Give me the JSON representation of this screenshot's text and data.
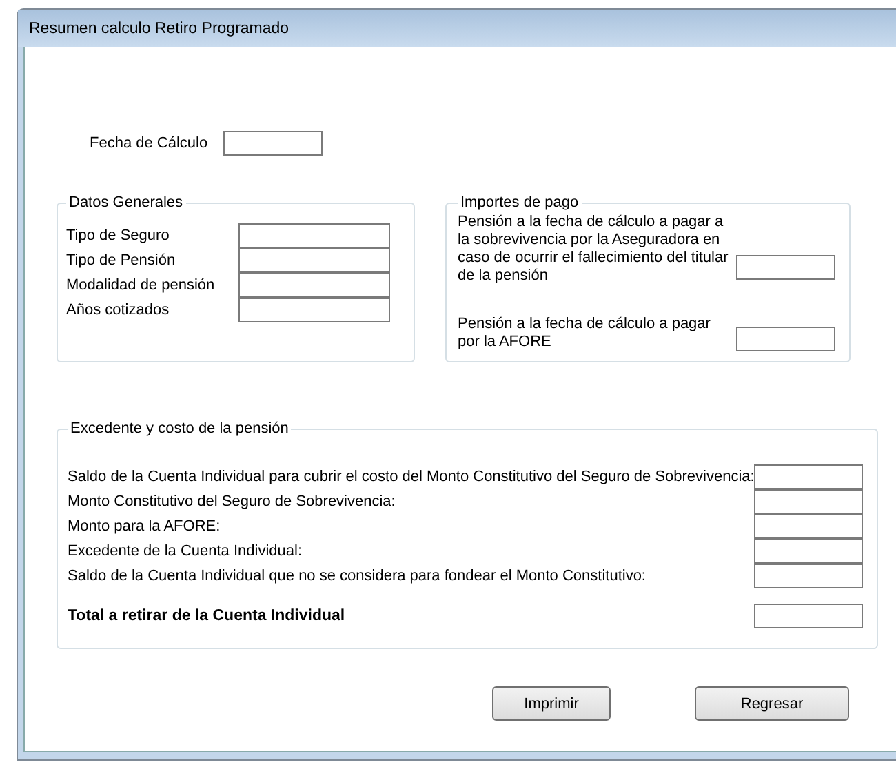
{
  "window": {
    "title": "Resumen calculo Retiro Programado"
  },
  "fecha_calculo": {
    "label": "Fecha de Cálculo"
  },
  "datos_generales": {
    "title": "Datos Generales",
    "rows": [
      {
        "label": "Tipo de Seguro"
      },
      {
        "label": "Tipo de Pensión"
      },
      {
        "label": "Modalidad de pensión"
      },
      {
        "label": "Años cotizados"
      }
    ]
  },
  "importes_de_pago": {
    "title": "Importes de pago",
    "rows": [
      {
        "label": "Pensión a la fecha de cálculo a pagar a la sobrevivencia por la Aseguradora en caso de ocurrir el fallecimiento del titular de la pensión"
      },
      {
        "label": "Pensión a la fecha de cálculo a pagar por la AFORE"
      }
    ]
  },
  "excedente": {
    "title": "Excedente y costo de la pensión",
    "rows": [
      {
        "kind": "line",
        "label": "Saldo de la Cuenta Individual para cubrir el costo del Monto Constitutivo del Seguro de Sobrevivencia:"
      },
      {
        "kind": "line",
        "label": "Monto Constitutivo del Seguro de Sobrevivencia:"
      },
      {
        "kind": "line",
        "label": "Monto para la AFORE:"
      },
      {
        "kind": "line",
        "label": "Excedente de la Cuenta Individual:"
      },
      {
        "kind": "line",
        "label": "Saldo de la Cuenta Individual que no se considera para fondear el Monto Constitutivo:"
      },
      {
        "kind": "total",
        "label": "Total a retirar de la Cuenta Individual"
      }
    ]
  },
  "buttons": [
    "Imprimir",
    "Regresar"
  ]
}
